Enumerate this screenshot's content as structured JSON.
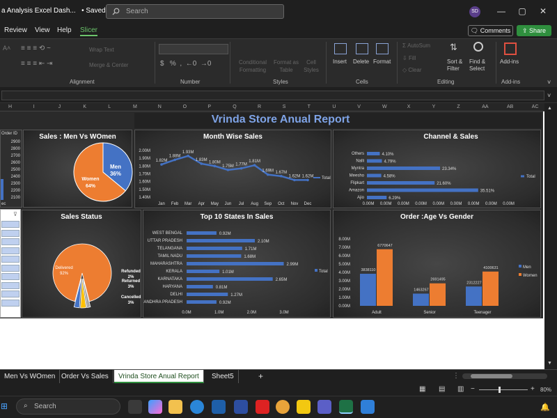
{
  "window": {
    "title": "a Analysis Excel Dash...",
    "saved": "• Saved",
    "search_placeholder": "Search",
    "avatar_initials": "SD",
    "minimize": "—",
    "maximize": "▢",
    "close": "✕"
  },
  "menu": {
    "items": [
      "Review",
      "View",
      "Help",
      "Slicer"
    ],
    "comments": "Comments",
    "share": "Share"
  },
  "ribbon": {
    "wrap_text": "Wrap Text",
    "merge_center": "Merge & Center",
    "conditional_formatting": "Conditional Formatting",
    "format_as_table": "Format as Table",
    "cell_styles": "Cell Styles",
    "insert": "Insert",
    "delete": "Delete",
    "format": "Format",
    "autosum": "AutoSum",
    "fill": "Fill",
    "clear": "Clear",
    "sort_filter": "Sort & Filter",
    "find_select": "Find & Select",
    "add_ins": "Add-ins",
    "groups": [
      "Alignment",
      "Number",
      "Styles",
      "Cells",
      "Editing",
      "Add-ins"
    ],
    "currency_symbol": "$",
    "percent_symbol": "%"
  },
  "columns": [
    "H",
    "I",
    "J",
    "K",
    "L",
    "M",
    "N",
    "O",
    "P",
    "Q",
    "R",
    "S",
    "T",
    "U",
    "V",
    "W",
    "X",
    "Y",
    "Z",
    "AA",
    "AB",
    "AC"
  ],
  "dashboard": {
    "title": "Vrinda Store Anual Report",
    "left_slicer": {
      "header": "Order ID",
      "values": [
        "2900",
        "2800",
        "2700",
        "2600",
        "2500",
        "2400",
        "2300",
        "2200",
        "2100"
      ],
      "footer": "ec"
    },
    "gender_chart": {
      "title": "Sales : Men Vs WOmen",
      "slices": [
        {
          "label": "Men",
          "value": "36%",
          "color": "#4472c4"
        },
        {
          "label": "Women",
          "value": "64%",
          "color": "#ed7d31"
        }
      ]
    },
    "status_chart": {
      "title": "Sales Status",
      "slices": [
        {
          "label": "Delivered",
          "value": "92%",
          "color": "#ed7d31"
        },
        {
          "label": "Refunded",
          "value": "2%",
          "color": "#a5a5a5"
        },
        {
          "label": "Returned",
          "value": "3%",
          "color": "#ffc000"
        },
        {
          "label": "Cancelled",
          "value": "3%",
          "color": "#4472c4"
        }
      ]
    },
    "legend_total": "Total",
    "men_label": "Men",
    "women_label": "Women"
  },
  "chart_data": [
    {
      "type": "line",
      "title": "Month Wise Sales",
      "categories": [
        "Jan",
        "Feb",
        "Mar",
        "Apr",
        "May",
        "Jun",
        "Jul",
        "Aug",
        "Sep",
        "Oct",
        "Nov",
        "Dec"
      ],
      "series": [
        {
          "name": "Total",
          "values": [
            1.82,
            1.88,
            1.93,
            1.83,
            1.8,
            1.75,
            1.77,
            1.81,
            1.69,
            1.67,
            1.62,
            1.62
          ]
        }
      ],
      "data_labels": [
        "1.82M",
        "1.88M",
        "1.93M",
        "1.83M",
        "1.80M",
        "1.75M",
        "1.77M",
        "1.81M",
        "1.69M",
        "1.67M",
        "1.62M",
        "1.62M"
      ],
      "yticks": [
        "2.00M",
        "1.90M",
        "1.80M",
        "1.70M",
        "1.60M",
        "1.50M",
        "1.40M"
      ],
      "ylim": [
        1.4,
        2.0
      ]
    },
    {
      "type": "bar",
      "title": "Channel & Sales",
      "categories": [
        "Others",
        "Nalli",
        "Myntra",
        "Meesho",
        "Flipkart",
        "Amazon",
        "Ajio"
      ],
      "series": [
        {
          "name": "Total",
          "values": [
            4.1,
            4.79,
            23.34,
            4.58,
            21.6,
            35.51,
            6.29
          ]
        }
      ],
      "data_labels": [
        "4.10%",
        "4.79%",
        "23.34%",
        "4.58%",
        "21.60%",
        "35.51%",
        "6.29%"
      ],
      "xticks": [
        "0.00M",
        "0.00M",
        "0.00M",
        "0.00M",
        "0.00M",
        "0.00M",
        "0.00M",
        "0.00M",
        "0.00M"
      ]
    },
    {
      "type": "bar",
      "title": "Top 10 States In Sales",
      "categories": [
        "WEST BENGAL",
        "UTTAR PRADESH",
        "TELANGANA",
        "TAMIL NADU",
        "MAHARASHTRA",
        "KERALA",
        "KARNATAKA",
        "HARYANA",
        "DELHI",
        "ANDHRA PRADESH"
      ],
      "series": [
        {
          "name": "Total",
          "values": [
            0.92,
            2.1,
            1.71,
            1.68,
            2.99,
            1.01,
            2.65,
            0.81,
            1.27,
            0.92
          ]
        }
      ],
      "data_labels": [
        "0.92M",
        "2.10M",
        "1.71M",
        "1.68M",
        "2.99M",
        "1.01M",
        "2.65M",
        "0.81M",
        "1.27M",
        "0.92M"
      ],
      "xticks": [
        "0.0M",
        "1.0M",
        "2.0M",
        "3.0M"
      ],
      "xlim": [
        0,
        3.0
      ]
    },
    {
      "type": "bar",
      "title": "Order :Age Vs Gender",
      "categories": [
        "Adult",
        "Senior",
        "Teenager"
      ],
      "series": [
        {
          "name": "Men",
          "values": [
            3838110,
            1463267,
            2312227
          ]
        },
        {
          "name": "Women",
          "values": [
            6770647,
            2691495,
            4100631
          ]
        }
      ],
      "yticks": [
        "8.00M",
        "7.00M",
        "6.00M",
        "5.00M",
        "4.00M",
        "3.00M",
        "2.00M",
        "1.00M",
        "0.00M"
      ],
      "ylim": [
        0,
        8000000
      ]
    }
  ],
  "tabs": [
    "Men Vs WOmen",
    "Order Vs Sales",
    "Vrinda Store Anual Report",
    "Sheet5"
  ],
  "add_sheet": "+",
  "zoom": "80%",
  "taskbar": {
    "search_placeholder": "Search"
  }
}
